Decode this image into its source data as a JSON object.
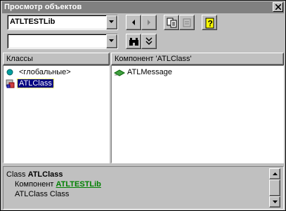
{
  "window": {
    "title": "Просмотр объектов"
  },
  "toolbar": {
    "library_value": "ATLTESTLib",
    "search_value": ""
  },
  "left_panel": {
    "header": "Классы",
    "items": [
      {
        "label": "<глобальные>",
        "icon": "globe-dot-icon"
      },
      {
        "label": "ATLClass",
        "icon": "class-icon",
        "selected": true
      }
    ]
  },
  "right_panel": {
    "header": "Компонент 'ATLClass'",
    "items": [
      {
        "label": "ATLMessage",
        "icon": "method-icon"
      }
    ]
  },
  "description": {
    "line1_prefix": "Class ",
    "line1_name": "ATLClass",
    "line2_prefix": "Компонент ",
    "line2_link": "ATLTESTLib",
    "line3": "ATLClass Class"
  },
  "colors": {
    "titlebar": "#808080",
    "selection": "#000080",
    "link": "#008000"
  }
}
